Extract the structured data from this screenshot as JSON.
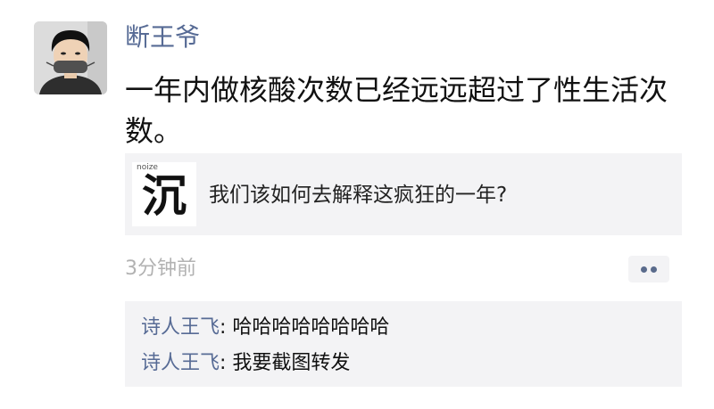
{
  "post": {
    "username": "断王爷",
    "text": "一年内做核酸次数已经远远超过了性生活次数。",
    "avatar_icon": "user-avatar-icon",
    "link": {
      "thumb_char": "沉",
      "thumb_tag": "noize",
      "title": "我们该如何去解释这疯狂的一年?"
    },
    "time": "3分钟前",
    "more_icon": "more-dots-icon"
  },
  "comments": [
    {
      "author": "诗人王飞",
      "sep": ": ",
      "text": "哈哈哈哈哈哈哈哈"
    },
    {
      "author": "诗人王飞",
      "sep": ": ",
      "text": "我要截图转发"
    }
  ],
  "colors": {
    "link_name": "#576b95",
    "card_bg": "#f3f3f5",
    "time_gray": "#b2b2b2",
    "text": "#111111"
  }
}
